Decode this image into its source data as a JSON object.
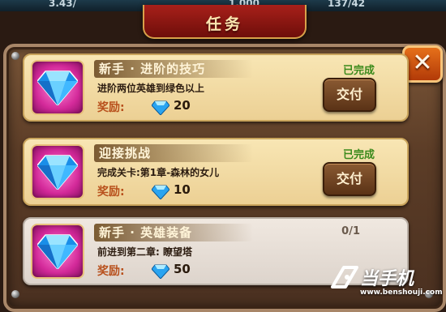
{
  "header": {
    "title": "任务",
    "close_icon": "close-icon",
    "top_stats": [
      "3.43/",
      "1.000",
      "137/42"
    ]
  },
  "tasks": [
    {
      "title": "新手 · 进阶的技巧",
      "description": "进阶两位英雄到绿色以上",
      "reward_label": "奖励:",
      "reward_amount": "20",
      "reward_icon": "diamond-icon",
      "status": "已完成",
      "button_label": "交付"
    },
    {
      "title": "迎接挑战",
      "description": "完成关卡:第1章-森林的女儿",
      "reward_label": "奖励:",
      "reward_amount": "10",
      "reward_icon": "diamond-icon",
      "status": "已完成",
      "button_label": "交付"
    },
    {
      "title": "新手 · 英雄装备",
      "description": "前进到第二章: 瞭望塔",
      "reward_label": "奖励:",
      "reward_amount": "50",
      "reward_icon": "diamond-icon",
      "status": "0/1"
    }
  ],
  "watermark": {
    "text": "当手机",
    "url": "www.benshouji.com"
  },
  "colors": {
    "done_row": "#f3dca4",
    "pending_row": "#e6ded6",
    "status_done": "#3b8a1c",
    "gem_blue": "#3ab4ff",
    "icon_bg": "#d42a9a"
  }
}
